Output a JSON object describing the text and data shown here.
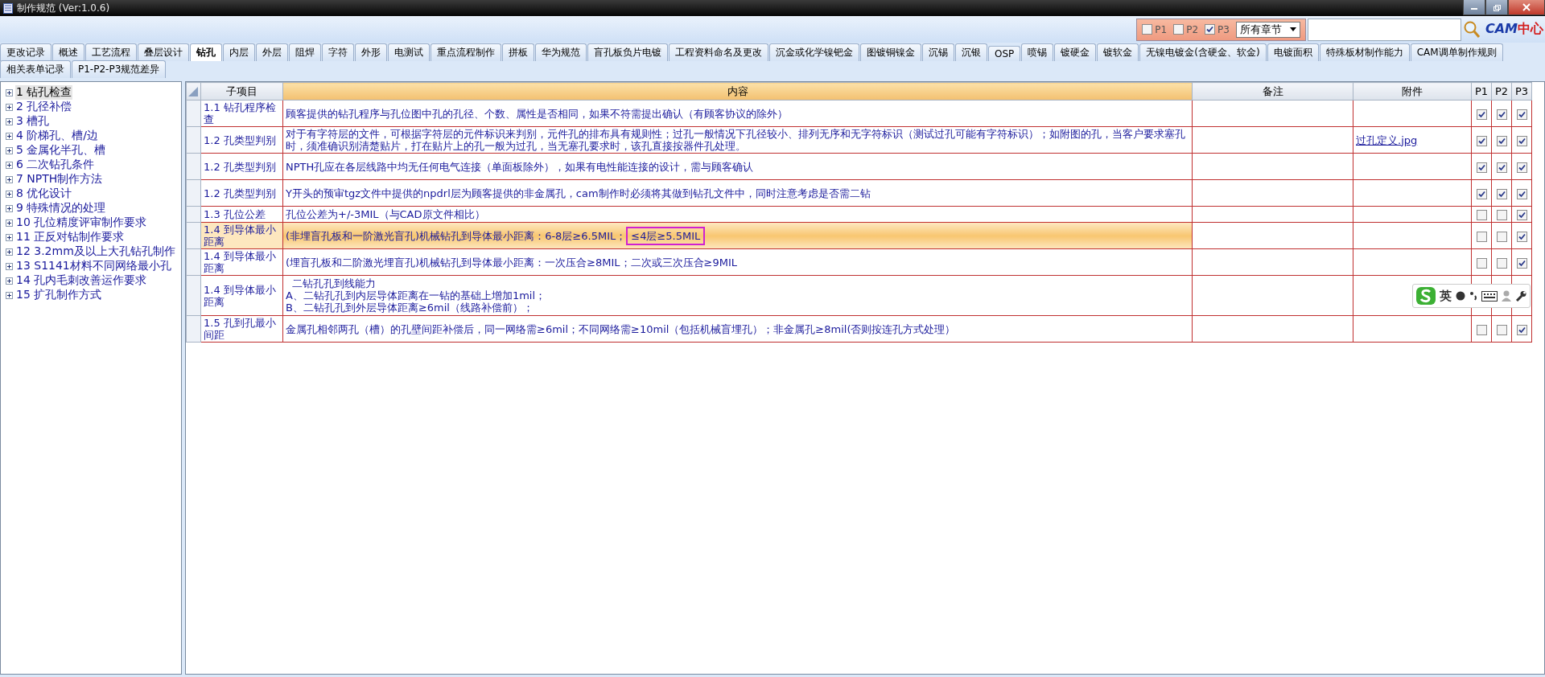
{
  "window": {
    "title": "制作规范 (Ver:1.0.6)"
  },
  "filter": {
    "levels": [
      {
        "label": "P1",
        "checked": false
      },
      {
        "label": "P2",
        "checked": false
      },
      {
        "label": "P3",
        "checked": true
      }
    ],
    "chapter": "所有章节",
    "logo": {
      "latin": "CAM",
      "cjk": "中心"
    }
  },
  "tab_rows": [
    [
      {
        "label": "更改记录",
        "selected": false
      },
      {
        "label": "概述",
        "selected": false
      },
      {
        "label": "工艺流程",
        "selected": false
      },
      {
        "label": "叠层设计",
        "selected": false
      },
      {
        "label": "钻孔",
        "selected": true
      },
      {
        "label": "内层",
        "selected": false
      },
      {
        "label": "外层",
        "selected": false
      },
      {
        "label": "阻焊",
        "selected": false
      },
      {
        "label": "字符",
        "selected": false
      },
      {
        "label": "外形",
        "selected": false
      },
      {
        "label": "电测试",
        "selected": false
      },
      {
        "label": "重点流程制作",
        "selected": false
      },
      {
        "label": "拼板",
        "selected": false
      },
      {
        "label": "华为规范",
        "selected": false
      },
      {
        "label": "盲孔板负片电镀",
        "selected": false
      },
      {
        "label": "工程资料命名及更改",
        "selected": false
      },
      {
        "label": "沉金或化学镍钯金",
        "selected": false
      },
      {
        "label": "图镀铜镍金",
        "selected": false
      },
      {
        "label": "沉锡",
        "selected": false
      },
      {
        "label": "沉银",
        "selected": false
      },
      {
        "label": "OSP",
        "selected": false
      },
      {
        "label": "喷锡",
        "selected": false
      },
      {
        "label": "镀硬金",
        "selected": false
      },
      {
        "label": "镀软金",
        "selected": false
      },
      {
        "label": "无镍电镀金(含硬金、软金)",
        "selected": false
      },
      {
        "label": "电镀面积",
        "selected": false
      },
      {
        "label": "特殊板材制作能力",
        "selected": false
      },
      {
        "label": "CAM调单制作规则",
        "selected": false
      }
    ],
    [
      {
        "label": "相关表单记录",
        "selected": false
      },
      {
        "label": "P1-P2-P3规范差异",
        "selected": false
      }
    ]
  ],
  "sidebar": {
    "items": [
      {
        "label": "1 钻孔检查",
        "selected": true
      },
      {
        "label": "2 孔径补偿",
        "selected": false
      },
      {
        "label": "3 槽孔",
        "selected": false
      },
      {
        "label": "4 阶梯孔、槽/边",
        "selected": false
      },
      {
        "label": "5 金属化半孔、槽",
        "selected": false
      },
      {
        "label": "6 二次钻孔条件",
        "selected": false
      },
      {
        "label": "7 NPTH制作方法",
        "selected": false
      },
      {
        "label": "8 优化设计",
        "selected": false
      },
      {
        "label": "9 特殊情况的处理",
        "selected": false
      },
      {
        "label": "10 孔位精度评审制作要求",
        "selected": false
      },
      {
        "label": "11 正反对钻制作要求",
        "selected": false
      },
      {
        "label": "12 3.2mm及以上大孔钻孔制作",
        "selected": false
      },
      {
        "label": "13 S1141材料不同网络最小孔",
        "selected": false
      },
      {
        "label": "14 孔内毛刺改善运作要求",
        "selected": false
      },
      {
        "label": "15 扩孔制作方式",
        "selected": false
      }
    ]
  },
  "table": {
    "columns": [
      "子项目",
      "内容",
      "备注",
      "附件",
      "P1",
      "P2",
      "P3"
    ],
    "rows": [
      {
        "sub_item": "1.1 钻孔程序检查",
        "content": "顾客提供的钻孔程序与孔位图中孔的孔径、个数、属性是否相同，如果不符需提出确认（有顾客协议的除外）",
        "selected": false,
        "p1": true,
        "p2": true,
        "p3": true
      },
      {
        "sub_item": "1.2 孔类型判别",
        "content": "对于有字符层的文件，可根据字符层的元件标识来判别，元件孔的排布具有规则性；过孔一般情况下孔径较小、排列无序和无字符标识（测试过孔可能有字符标识）；如附图的孔，当客户要求塞孔时，须准确识别清楚贴片，打在贴片上的孔一般为过孔，当无塞孔要求时，该孔直接按器件孔处理。",
        "attachment": "过孔定义.jpg",
        "selected": false,
        "p1": true,
        "p2": true,
        "p3": true
      },
      {
        "sub_item": "1.2 孔类型判别",
        "content": "NPTH孔应在各层线路中均无任何电气连接（单面板除外），如果有电性能连接的设计，需与顾客确认",
        "selected": false,
        "p1": true,
        "p2": true,
        "p3": true
      },
      {
        "sub_item": "1.2 孔类型判别",
        "content": "Y开头的预审tgz文件中提供的npdrl层为顾客提供的非金属孔，cam制作时必须将其做到钻孔文件中，同时注意考虑是否需二钻",
        "selected": false,
        "p1": true,
        "p2": true,
        "p3": true
      },
      {
        "sub_item": "1.3 孔位公差",
        "content": "孔位公差为+/-3MIL（与CAD原文件相比）",
        "selected": false,
        "p1": false,
        "p2": false,
        "p3": true
      },
      {
        "sub_item": "1.4 到导体最小距离",
        "content": "(非埋盲孔板和一阶激光盲孔)机械钻孔到导体最小距离：6-8层≥6.5MIL；",
        "highlight": "≤4层≥5.5MIL",
        "selected": true,
        "p1": false,
        "p2": false,
        "p3": true
      },
      {
        "sub_item": "1.4 到导体最小距离",
        "content": "(埋盲孔板和二阶激光埋盲孔)机械钻孔到导体最小距离：一次压合≥8MIL；二次或三次压合≥9MIL",
        "selected": false,
        "p1": false,
        "p2": false,
        "p3": true
      },
      {
        "sub_item": "1.4 到导体最小距离",
        "content_lines": [
          "  二钻孔孔到线能力",
          "A、二钻孔孔到内层导体距离在一钻的基础上增加1mil；",
          "B、二钻孔孔到外层导体距离≥6mil（线路补偿前）；"
        ],
        "selected": false
      },
      {
        "sub_item": "1.5 孔到孔最小间距",
        "content": "金属孔相邻两孔（槽）的孔壁间距补偿后，同一网络需≥6mil；不同网络需≥10mil（包括机械盲埋孔）；非金属孔≥8mil(否则按连孔方式处理）",
        "selected": false,
        "p1": false,
        "p2": false,
        "p3": true
      }
    ]
  },
  "ime_toolbar": {
    "mode": "英"
  }
}
